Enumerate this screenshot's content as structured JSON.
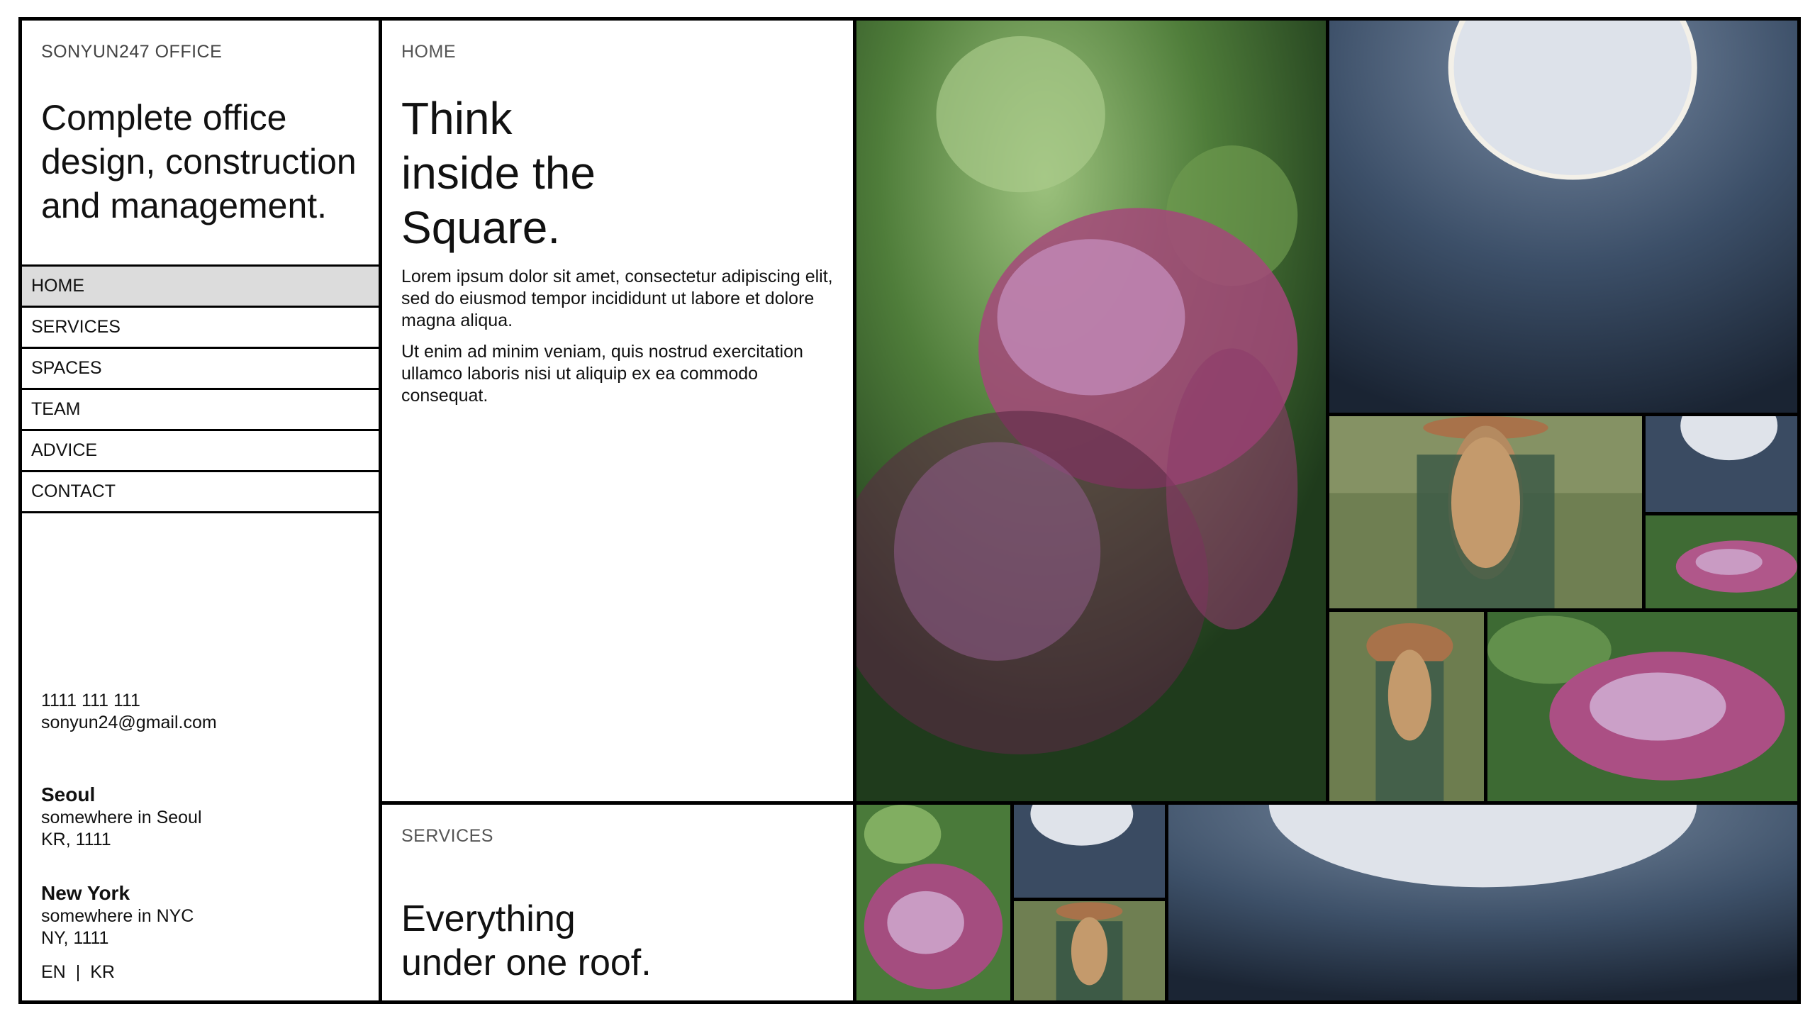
{
  "brand": "SONYUN247 OFFICE",
  "tagline": "Complete office design, construction and management.",
  "nav": [
    {
      "label": "HOME",
      "active": true
    },
    {
      "label": "SERVICES",
      "active": false
    },
    {
      "label": "SPACES",
      "active": false
    },
    {
      "label": "TEAM",
      "active": false
    },
    {
      "label": "ADVICE",
      "active": false
    },
    {
      "label": "CONTACT",
      "active": false
    }
  ],
  "contact": {
    "phone": "1111 111 111",
    "email": "sonyun24@gmail.com"
  },
  "offices": [
    {
      "city": "Seoul",
      "line1": "somewhere in Seoul",
      "line2": "KR, 1111"
    },
    {
      "city": "New York",
      "line1": "somewhere in NYC",
      "line2": "NY, 1111"
    }
  ],
  "languages": {
    "en": "EN",
    "separator": "|",
    "kr": "KR"
  },
  "home": {
    "label": "HOME",
    "headline_lines": [
      "Think",
      "inside the",
      "Square."
    ],
    "paragraphs": [
      "Lorem ipsum dolor sit amet, consectetur adipiscing elit, sed do eiusmod tempor incididunt ut labore et dolore magna aliqua.",
      "Ut enim ad minim veniam, quis nostrud exercitation ullamco laboris nisi ut aliquip ex ea commodo consequat."
    ]
  },
  "services": {
    "label": "SERVICES",
    "headline_lines": [
      "Everything",
      "under one roof."
    ]
  },
  "gallery": {
    "images": [
      "lilac-photo",
      "tower-photo",
      "woman-in-field-photo"
    ],
    "colors": {
      "lilac": "#b0578a",
      "leaf": "#3f6b34",
      "tower": "#3a4a5e",
      "sky": "#dfe3ea",
      "wheat": "#7a8c5a",
      "hat": "#a8724a"
    }
  }
}
